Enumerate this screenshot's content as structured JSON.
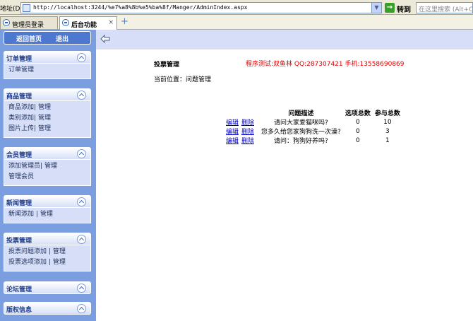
{
  "browser": {
    "address_label": "地址(D)",
    "url": "http://localhost:3244/%e7%a8%8b%e5%ba%8f/Manger/AdminIndex.aspx",
    "go_label": "转到",
    "search_placeholder": "在这里搜索 (Alt+C)",
    "tabs": [
      {
        "label": "管理员登录",
        "active": false
      },
      {
        "label": "后台功能",
        "active": true,
        "close": "×"
      }
    ],
    "new_tab": "+"
  },
  "sidebar": {
    "home_label": "返回首页",
    "logout_label": "退出",
    "groups": [
      {
        "title": "订单管理",
        "rows": [
          [
            "订单管理"
          ]
        ]
      },
      {
        "title": "商品管理",
        "rows": [
          [
            "商品添加",
            "|",
            "管理"
          ],
          [
            "类别添加",
            "|",
            "管理"
          ],
          [
            "图片上传",
            "|",
            "管理"
          ]
        ]
      },
      {
        "title": "会员管理",
        "rows": [
          [
            "添加管理员",
            "|",
            "管理"
          ],
          [
            "管理会员"
          ]
        ]
      },
      {
        "title": "新闻管理",
        "rows": [
          [
            "新闻添加",
            "|",
            "管理"
          ]
        ]
      },
      {
        "title": "投票管理",
        "rows": [
          [
            "投票问题添加",
            "|",
            "管理"
          ],
          [
            "投票选项添加",
            "|",
            "管理"
          ]
        ]
      },
      {
        "title": "论坛管理",
        "rows": []
      },
      {
        "title": "版权信息",
        "rows": []
      }
    ]
  },
  "main": {
    "title": "投票管理",
    "dev_info": "程序测试:双鱼林  QQ:287307421  手机:13558690869",
    "breadcrumb": "当前位置：问题管理",
    "table": {
      "headers": [
        "",
        "问题描述",
        "选项总数",
        "参与总数"
      ],
      "edit_label": "编辑",
      "delete_label": "删除",
      "rows": [
        {
          "question": "请问大家爱猫咪吗?",
          "options": "0",
          "participants": "10"
        },
        {
          "question": "您多久给您家狗狗洗一次澡?",
          "options": "0",
          "participants": "3"
        },
        {
          "question": "请问：狗狗好养吗?",
          "options": "0",
          "participants": "1"
        }
      ]
    }
  }
}
